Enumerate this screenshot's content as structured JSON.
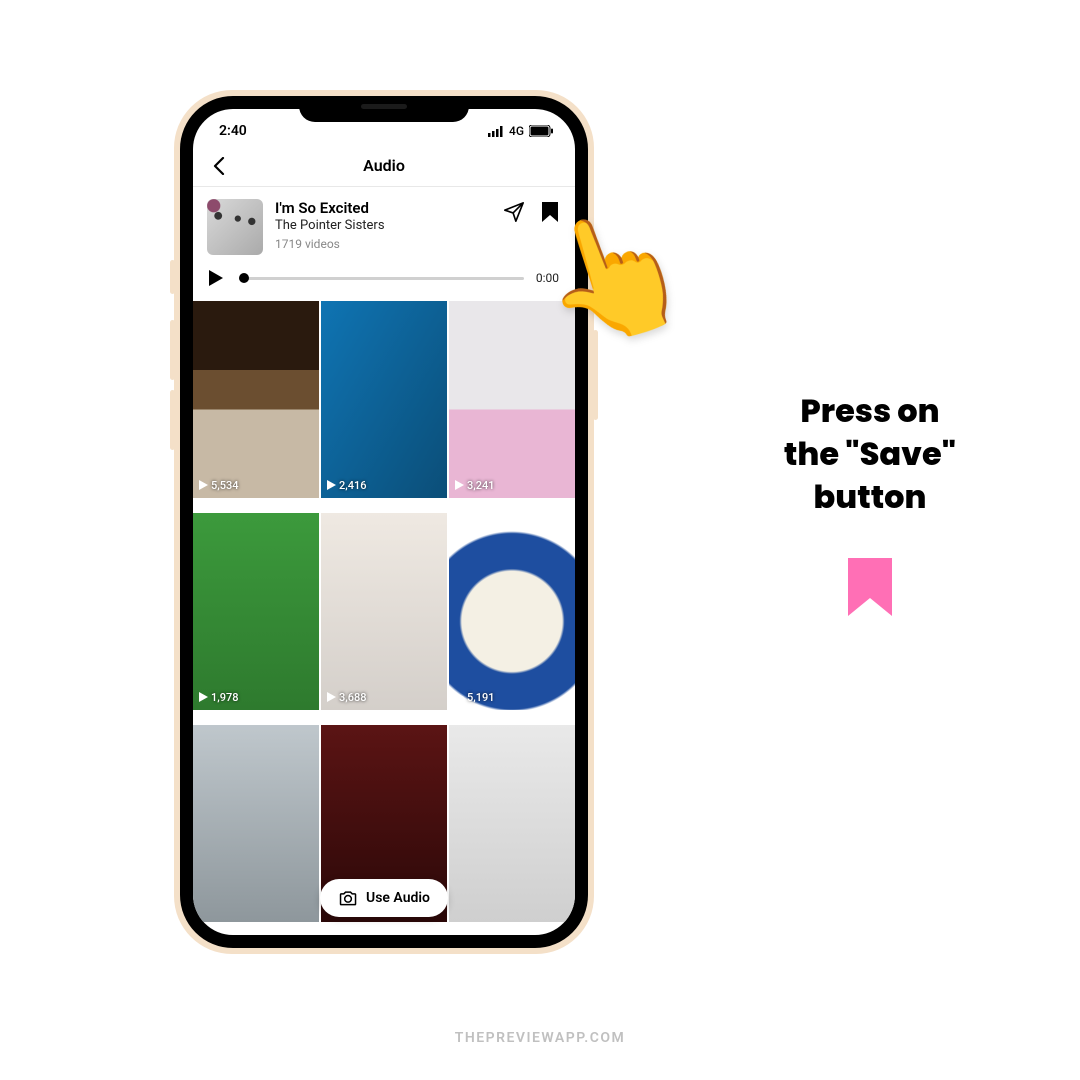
{
  "status": {
    "time": "2:40",
    "network": "4G"
  },
  "nav": {
    "title": "Audio"
  },
  "audio": {
    "track_title": "I'm So Excited",
    "artist": "The Pointer Sisters",
    "video_count": "1719 videos"
  },
  "player": {
    "time": "0:00"
  },
  "grid": {
    "cells": [
      {
        "views": "5,534"
      },
      {
        "views": "2,416"
      },
      {
        "views": "3,241"
      },
      {
        "views": "1,978"
      },
      {
        "views": "3,688"
      },
      {
        "views": "5,191"
      },
      {
        "views": ""
      },
      {
        "views": ""
      },
      {
        "views": ""
      }
    ]
  },
  "use_audio_label": "Use Audio",
  "instruction": "Press on\nthe \"Save\"\nbutton",
  "watermark": "THEPREVIEWAPP.COM",
  "colors": {
    "accent_pink": "#ff6fb5",
    "pointer_yellow": "#ffcf3a"
  }
}
